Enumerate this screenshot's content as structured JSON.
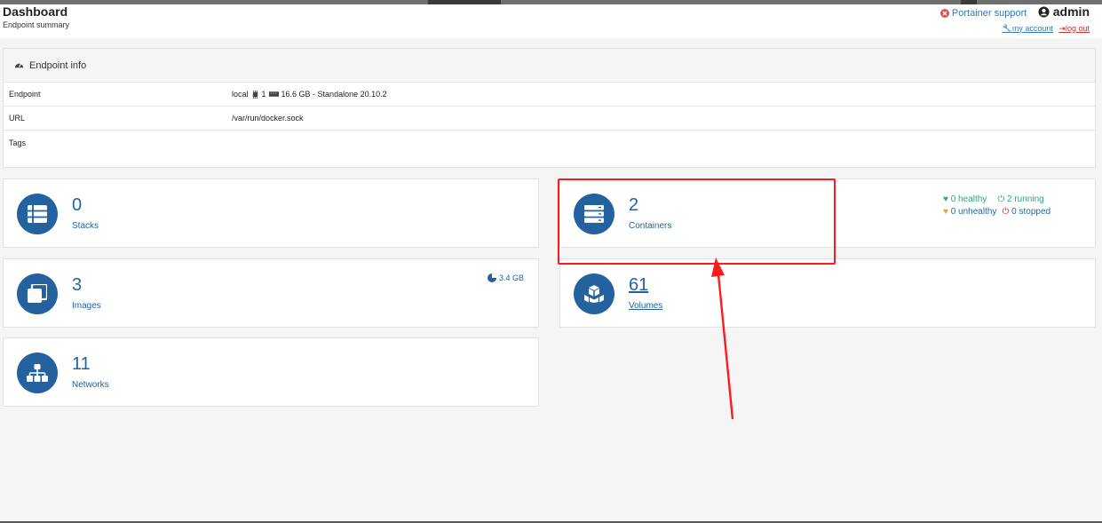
{
  "header": {
    "title": "Dashboard",
    "subtitle": "Endpoint summary",
    "support_label": "Portainer support",
    "username": "admin",
    "my_account": "my account",
    "log_out": "log out"
  },
  "endpoint_panel": {
    "title": "Endpoint info",
    "rows": [
      {
        "key": "Endpoint",
        "value_name": "local",
        "cpu": "1",
        "memory": "16.6 GB - Standalone 20.10.2"
      },
      {
        "key": "URL",
        "value": "/var/run/docker.sock"
      },
      {
        "key": "Tags",
        "value": ""
      }
    ]
  },
  "cards": {
    "stacks": {
      "count": "0",
      "label": "Stacks"
    },
    "containers": {
      "count": "2",
      "label": "Containers",
      "healthy": "0 healthy",
      "unhealthy": "0 unhealthy",
      "running": "2 running",
      "stopped": "0 stopped"
    },
    "images": {
      "count": "3",
      "label": "Images",
      "size": "3.4 GB"
    },
    "volumes": {
      "count": "61",
      "label": "Volumes"
    },
    "networks": {
      "count": "11",
      "label": "Networks"
    }
  },
  "colors": {
    "accent": "#23629f",
    "highlight": "#ff1b1b",
    "healthy": "#2aa87a",
    "stopped": "#c9302c"
  },
  "icons": [
    "portainer-support-icon",
    "user-circle-icon",
    "wrench-icon",
    "sign-out-icon",
    "tachometer-icon",
    "cpu-icon",
    "memory-icon",
    "stacks-icon",
    "containers-icon",
    "images-icon",
    "volumes-icon",
    "networks-icon",
    "pie-chart-icon",
    "heartbeat-icon",
    "power-icon"
  ]
}
